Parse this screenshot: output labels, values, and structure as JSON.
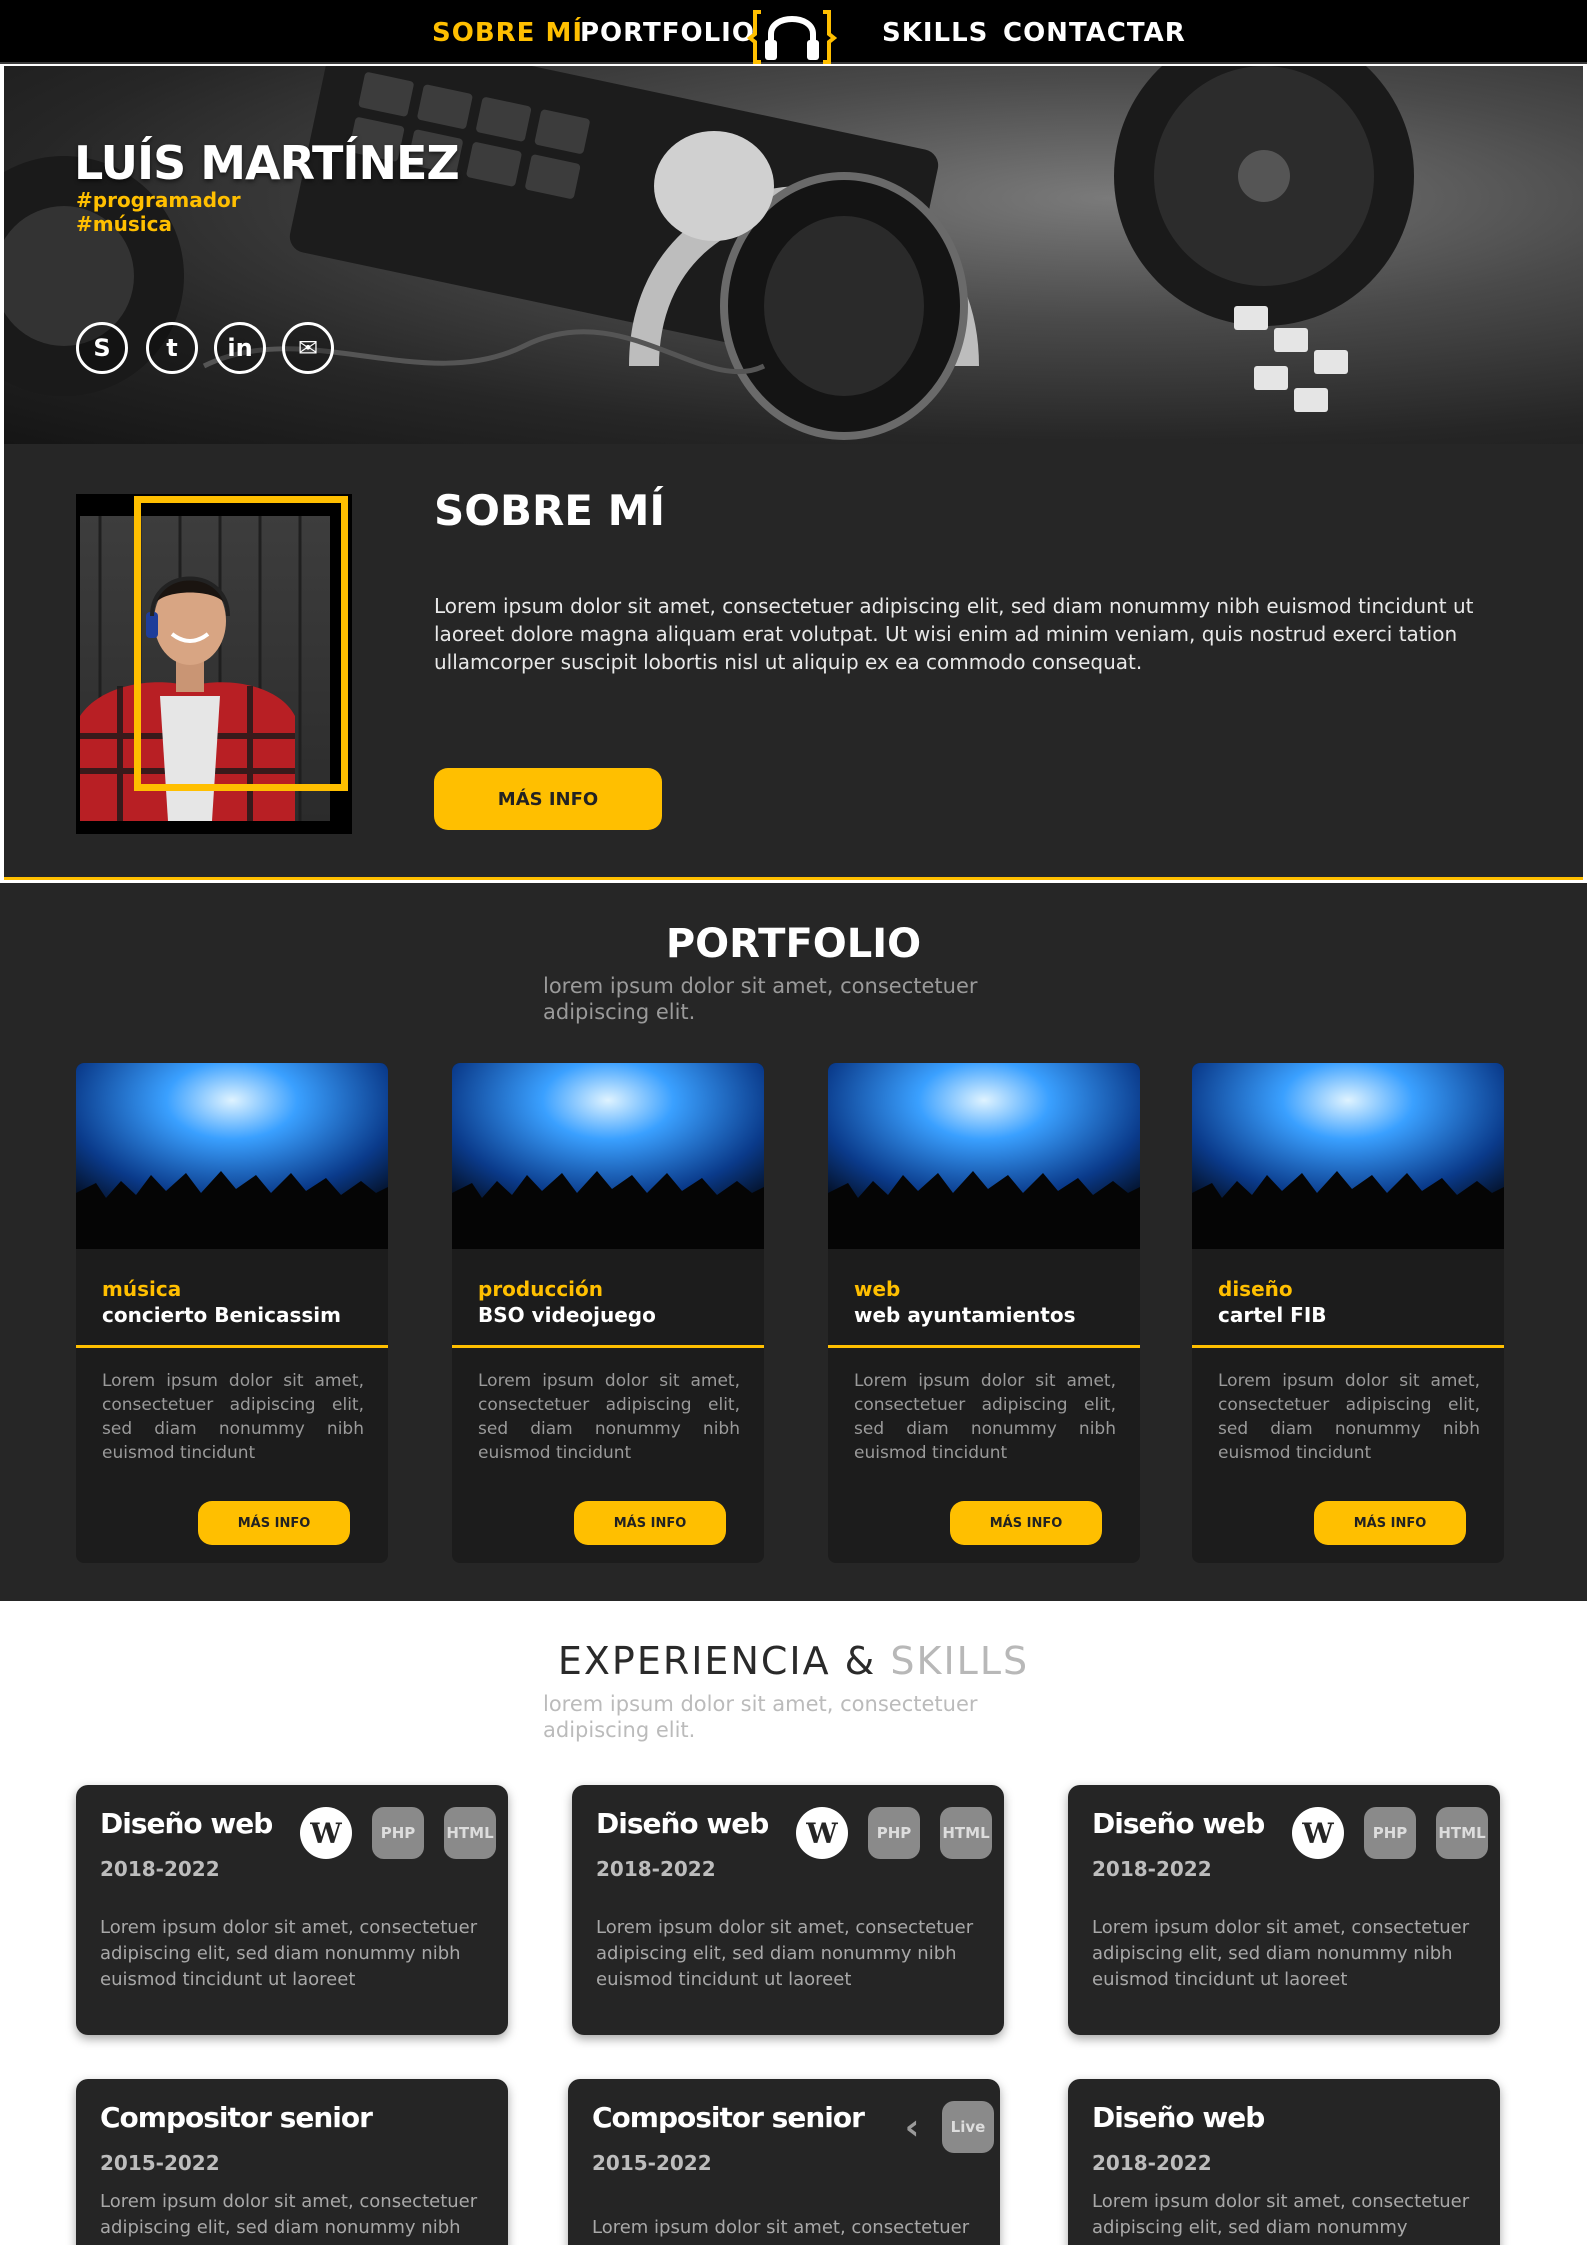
{
  "nav": {
    "items": [
      "SOBRE MÍ",
      "PORTFOLIO",
      "SKILLS",
      "CONTACTAR"
    ],
    "active": "SOBRE MÍ",
    "logo_icon": "headphones-icon"
  },
  "hero": {
    "name": "LUÍS MARTÍNEZ",
    "tags": [
      "#programador",
      "#música"
    ],
    "social": [
      {
        "icon": "skype-icon",
        "glyph": "S"
      },
      {
        "icon": "twitter-icon",
        "glyph": "t"
      },
      {
        "icon": "linkedin-icon",
        "glyph": "in"
      },
      {
        "icon": "email-icon",
        "glyph": "✉"
      }
    ]
  },
  "about": {
    "title": "SOBRE MÍ",
    "text": "Lorem ipsum dolor sit amet, consectetuer adipiscing elit, sed diam nonummy nibh euismod tincidunt ut laoreet dolore magna aliquam erat volutpat. Ut wisi enim ad minim veniam, quis nostrud exerci tation ullamcorper suscipit lobortis nisl ut aliquip ex ea commodo consequat.",
    "button": "MÁS INFO"
  },
  "portfolio": {
    "title": "PORTFOLIO",
    "subtitle": "lorem ipsum dolor sit amet, consectetuer adipiscing elit.",
    "cards": [
      {
        "category": "música",
        "title": "concierto Benicassim",
        "text": "Lorem ipsum dolor sit amet, consectetuer adipiscing elit, sed diam nonummy nibh euismod tincidunt",
        "button": "MÁS INFO"
      },
      {
        "category": "producción",
        "title": "BSO videojuego",
        "text": "Lorem ipsum dolor sit amet, consectetuer adipiscing elit, sed diam nonummy nibh euismod tincidunt",
        "button": "MÁS INFO"
      },
      {
        "category": "web",
        "title": "web ayuntamientos",
        "text": "Lorem ipsum dolor sit amet, consectetuer adipiscing elit, sed diam nonummy nibh euismod tincidunt",
        "button": "MÁS INFO"
      },
      {
        "category": "diseño",
        "title": "cartel FIB",
        "text": "Lorem ipsum dolor sit amet, consectetuer adipiscing elit, sed diam nonummy nibh euismod tincidunt",
        "button": "MÁS INFO"
      }
    ]
  },
  "skills": {
    "title_a": "EXPERIENCIA & ",
    "title_b": "SKILLS",
    "subtitle": "lorem ipsum dolor sit amet, consectetuer adipiscing elit.",
    "cards": [
      {
        "title": "Diseño web",
        "years": "2018-2022",
        "text": "Lorem ipsum dolor sit amet, consectetuer adipiscing elit, sed diam nonummy nibh euismod tincidunt ut laoreet",
        "icons": [
          "wordpress-icon",
          "php-icon",
          "html-icon"
        ]
      },
      {
        "title": "Diseño web",
        "years": "2018-2022",
        "text": "Lorem ipsum dolor sit amet, consectetuer adipiscing elit, sed diam nonummy nibh euismod tincidunt ut laoreet",
        "icons": [
          "wordpress-icon",
          "php-icon",
          "html-icon"
        ]
      },
      {
        "title": "Diseño web",
        "years": "2018-2022",
        "text": "Lorem ipsum dolor sit amet, consectetuer adipiscing elit, sed diam nonummy nibh euismod tincidunt ut laoreet",
        "icons": [
          "wordpress-icon",
          "php-icon",
          "html-icon"
        ]
      },
      {
        "title": "Compositor senior",
        "years": "2015-2022",
        "text": "Lorem ipsum dolor sit amet, consectetuer adipiscing elit, sed diam nonummy nibh",
        "icons": []
      },
      {
        "title": "Compositor senior",
        "years": "2015-2022",
        "text": "Lorem ipsum dolor sit amet, consectetuer",
        "icons": [
          "cubase-icon",
          "live-icon"
        ]
      },
      {
        "title": "Diseño web",
        "years": "2018-2022",
        "text": "Lorem ipsum dolor sit amet, consectetuer adipiscing elit, sed diam nonummy",
        "icons": []
      }
    ]
  },
  "colors": {
    "accent": "#ffbf00",
    "dark": "#262626",
    "black": "#000000"
  }
}
